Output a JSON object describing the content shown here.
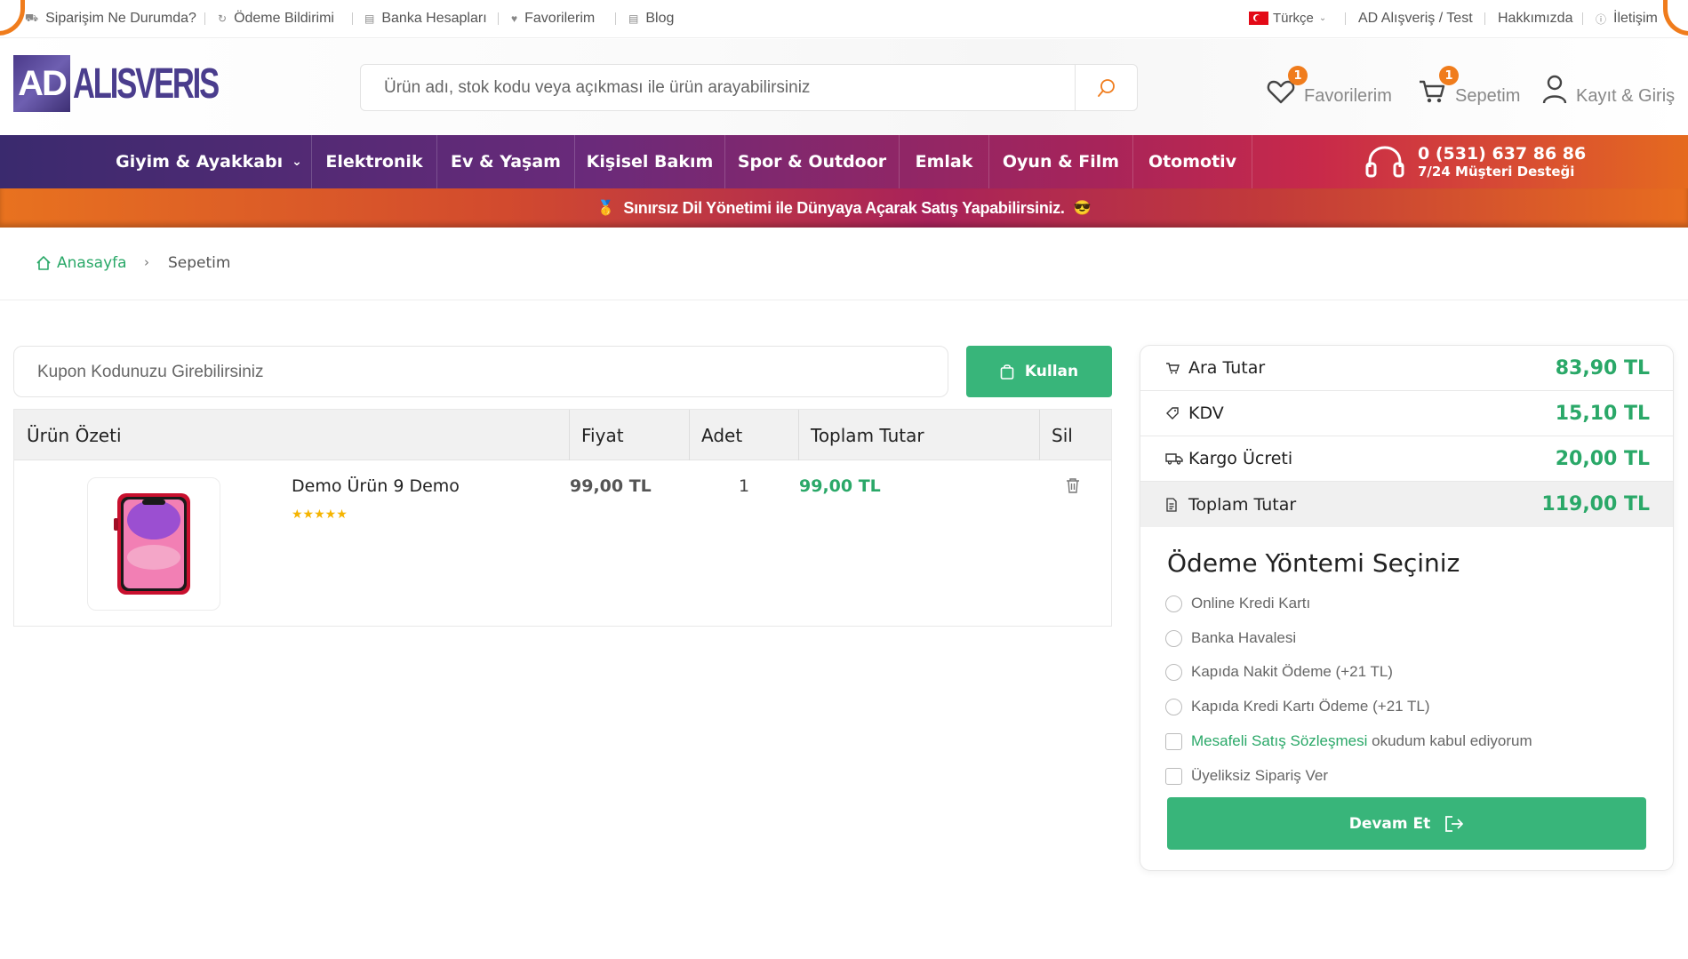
{
  "topbar": {
    "links": [
      {
        "label": "Siparişim Ne Durumda?",
        "icon": "truck-icon"
      },
      {
        "label": "Ödeme Bildirimi",
        "icon": "refresh-icon"
      },
      {
        "label": "Banka Hesapları",
        "icon": "document-icon"
      },
      {
        "label": "Favorilerim",
        "icon": "heart-icon"
      },
      {
        "label": "Blog",
        "icon": "document-icon"
      }
    ],
    "language": "Türkçe",
    "right_links": [
      "AD Alışveriş / Test",
      "Hakkımızda",
      "İletişim"
    ]
  },
  "header": {
    "logo_box": "AD",
    "logo_text": "ALISVERIS",
    "search_placeholder": "Ürün adı, stok kodu veya açıkması ile ürün arayabilirsiniz",
    "favorites_label": "Favorilerim",
    "favorites_count": "1",
    "cart_label": "Sepetim",
    "cart_count": "1",
    "account_label": "Kayıt & Giriş"
  },
  "nav": {
    "items": [
      "Giyim & Ayakkabı",
      "Elektronik",
      "Ev & Yaşam",
      "Kişisel Bakım",
      "Spor & Outdoor",
      "Emlak",
      "Oyun & Film",
      "Otomotiv"
    ],
    "phone": "0 (531) 637 86 86",
    "support": "7/24 Müşteri Desteği"
  },
  "announcement": "Sınırsız Dil Yönetimi ile Dünyaya Açarak Satış Yapabilirsiniz.",
  "breadcrumb": {
    "home": "Anasayfa",
    "current": "Sepetim"
  },
  "coupon": {
    "placeholder": "Kupon Kodunuzu Girebilirsiniz",
    "button": "Kullan"
  },
  "cart": {
    "headers": [
      "Ürün Özeti",
      "Fiyat",
      "Adet",
      "Toplam Tutar",
      "Sil"
    ],
    "items": [
      {
        "name": "Demo Ürün 9 Demo",
        "price": "99,00 TL",
        "qty": "1",
        "total": "99,00 TL",
        "rating": 5
      }
    ]
  },
  "summary": {
    "rows": [
      {
        "label": "Ara Tutar",
        "value": "83,90 TL",
        "icon": "cart-icon"
      },
      {
        "label": "KDV",
        "value": "15,10 TL",
        "icon": "tag-icon"
      },
      {
        "label": "Kargo Ücreti",
        "value": "20,00 TL",
        "icon": "truck-icon"
      },
      {
        "label": "Toplam Tutar",
        "value": "119,00 TL",
        "icon": "document-icon"
      }
    ],
    "payment_title": "Ödeme Yöntemi Seçiniz",
    "payment_options": [
      "Online Kredi Kartı",
      "Banka Havalesi",
      "Kapıda Nakit Ödeme (+21 TL)",
      "Kapıda Kredi Kartı Ödeme (+21 TL)"
    ],
    "agreement_link": "Mesafeli Satış Sözleşmesi",
    "agreement_text": " okudum kabul ediyorum",
    "guest_checkout": "Üyeliksiz Sipariş Ver",
    "continue_button": "Devam Et"
  },
  "colors": {
    "accent_green": "#38b57a",
    "accent_orange": "#f07c1c",
    "brand_purple": "#4a3d8d"
  }
}
